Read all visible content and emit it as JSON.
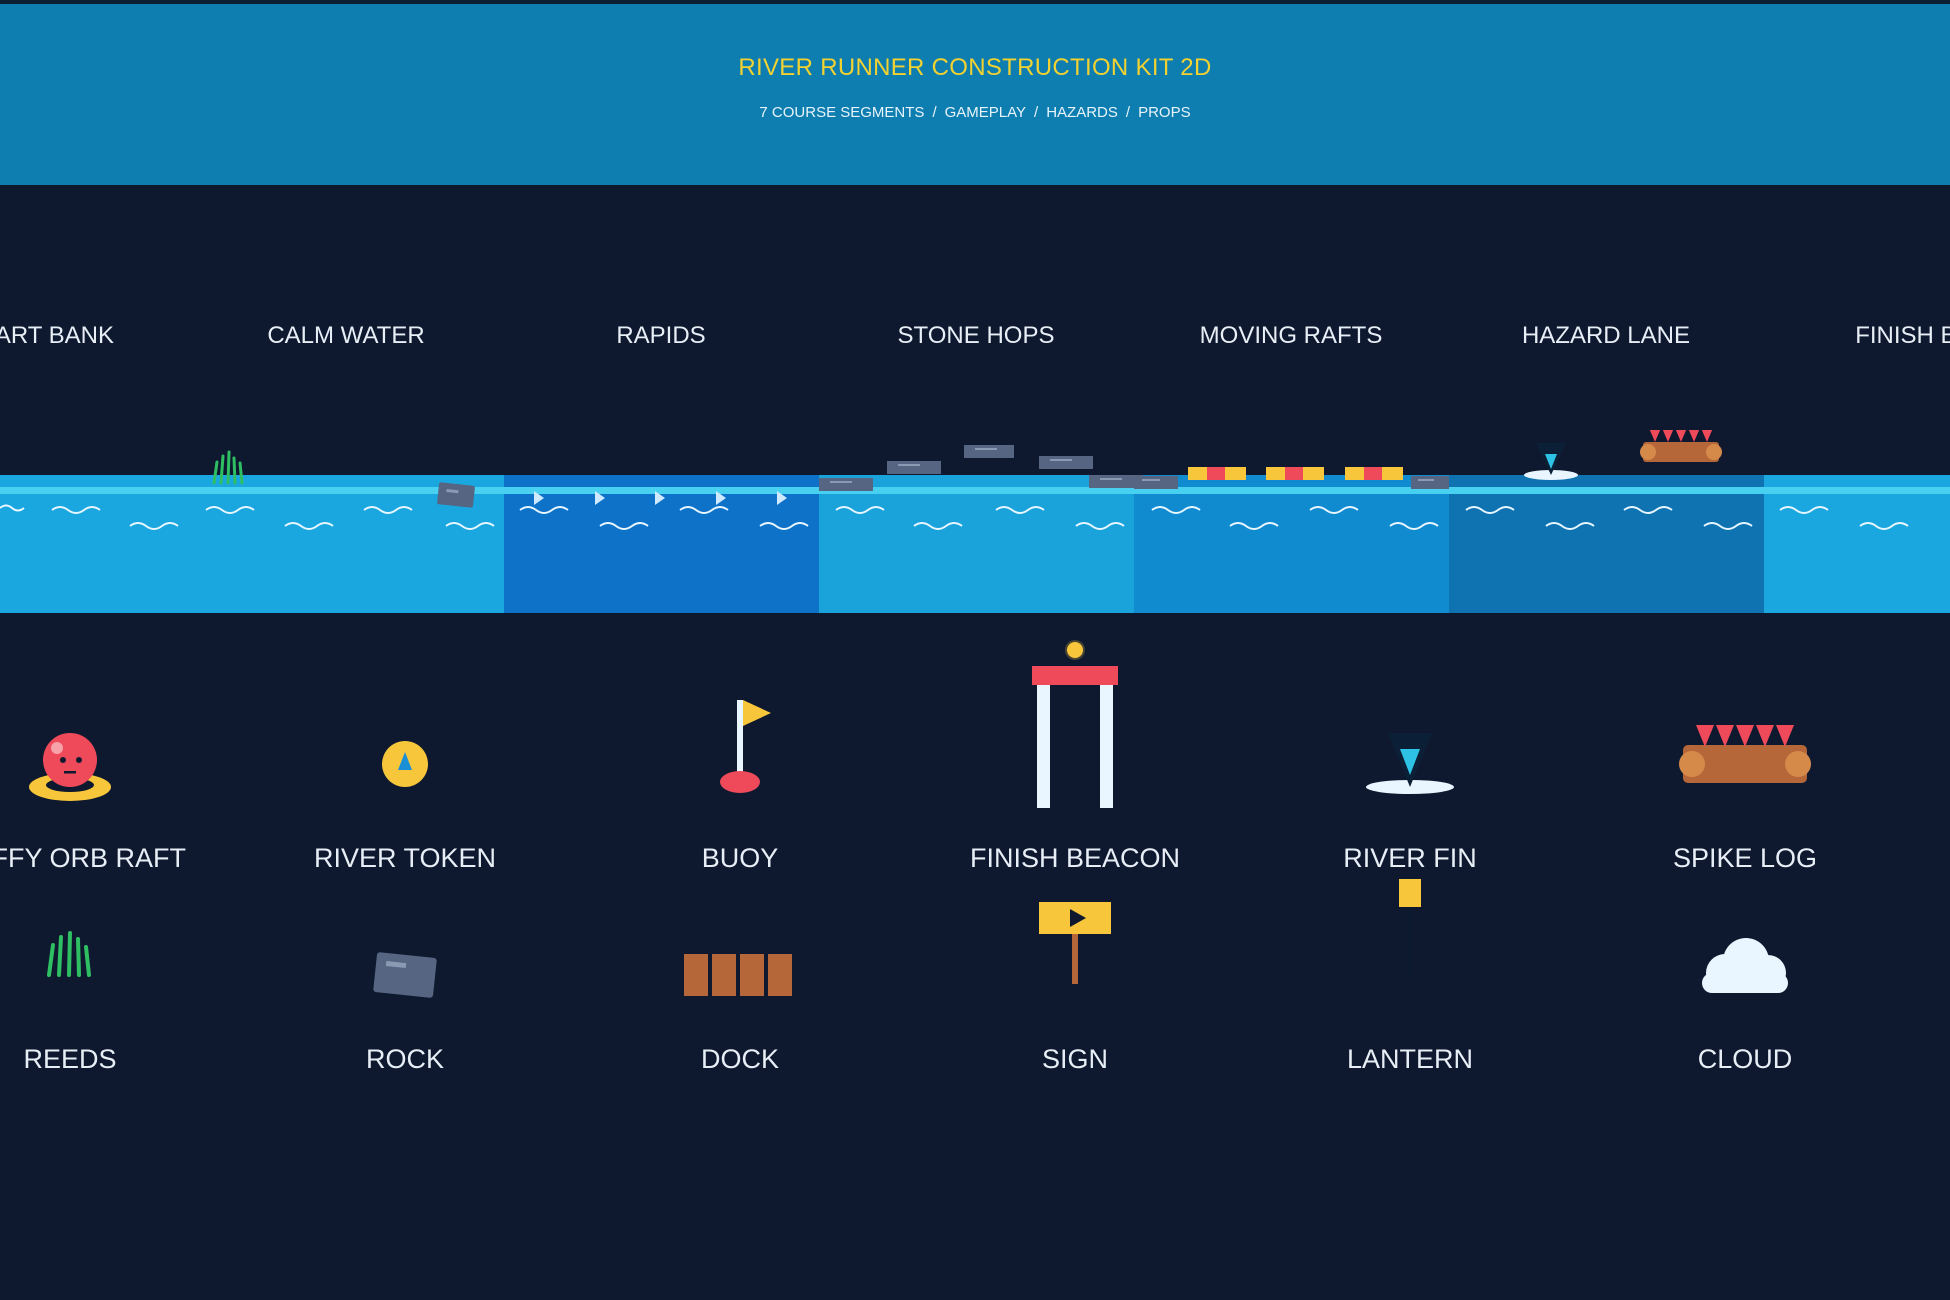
{
  "header": {
    "title": "RIVER RUNNER CONSTRUCTION KIT 2D",
    "subtitle_items": [
      "7 COURSE SEGMENTS",
      "GAMEPLAY",
      "HAZARDS",
      "PROPS"
    ],
    "separator": "/"
  },
  "segments": [
    {
      "label": "START BANK"
    },
    {
      "label": "CALM WATER"
    },
    {
      "label": "RAPIDS"
    },
    {
      "label": "STONE HOPS"
    },
    {
      "label": "MOVING RAFTS"
    },
    {
      "label": "HAZARD LANE"
    },
    {
      "label": "FINISH BAY"
    }
  ],
  "props_row1": [
    {
      "label": "PUFFY ORB RAFT",
      "icon": "orb-raft-icon"
    },
    {
      "label": "RIVER TOKEN",
      "icon": "river-token-icon"
    },
    {
      "label": "BUOY",
      "icon": "buoy-icon"
    },
    {
      "label": "FINISH BEACON",
      "icon": "finish-beacon-icon"
    },
    {
      "label": "RIVER FIN",
      "icon": "river-fin-icon"
    },
    {
      "label": "SPIKE LOG",
      "icon": "spike-log-icon"
    }
  ],
  "props_row2": [
    {
      "label": "REEDS",
      "icon": "reeds-icon"
    },
    {
      "label": "ROCK",
      "icon": "rock-icon"
    },
    {
      "label": "DOCK",
      "icon": "dock-icon"
    },
    {
      "label": "SIGN",
      "icon": "sign-icon"
    },
    {
      "label": "LANTERN",
      "icon": "lantern-icon"
    },
    {
      "label": "CLOUD",
      "icon": "cloud-icon"
    }
  ],
  "colors": {
    "background": "#0e1930",
    "header": "#0e7db0",
    "title": "#f2d231",
    "water_light": "#1aa7df",
    "water_rapids": "#0e72c8",
    "water_mid": "#118bd0",
    "water_hazard": "#0f73b2",
    "accent_red": "#ef4a5a",
    "accent_yellow": "#f7c63a",
    "wood": "#b5673a",
    "stone": "#566682"
  }
}
